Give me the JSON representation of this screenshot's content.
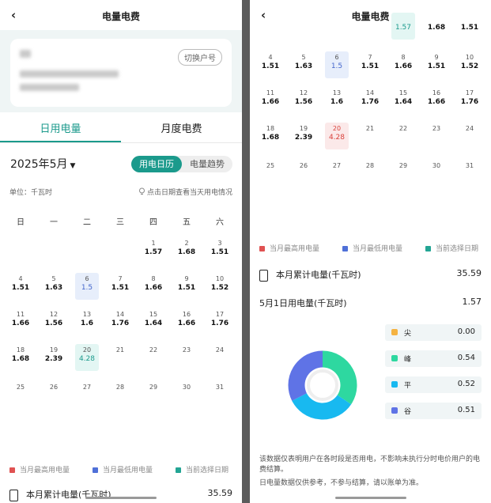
{
  "header": {
    "back": "‹",
    "title": "电量电费"
  },
  "account": {
    "switch_label": "切换户号"
  },
  "tabs": {
    "daily": "日用电量",
    "monthly": "月度电费"
  },
  "month": "2025年5月",
  "toggle": {
    "calendar": "用电日历",
    "trend": "电量趋势"
  },
  "unit_label": "单位：千瓦时",
  "tip": "点击日期查看当天用电情况",
  "weekdays": [
    "日",
    "一",
    "二",
    "三",
    "四",
    "五",
    "六"
  ],
  "days": [
    {
      "d": "1",
      "v": "1.57"
    },
    {
      "d": "2",
      "v": "1.68"
    },
    {
      "d": "3",
      "v": "1.51"
    },
    {
      "d": "4",
      "v": "1.51"
    },
    {
      "d": "5",
      "v": "1.63"
    },
    {
      "d": "6",
      "v": "1.5",
      "status": "low"
    },
    {
      "d": "7",
      "v": "1.51"
    },
    {
      "d": "8",
      "v": "1.66"
    },
    {
      "d": "9",
      "v": "1.51"
    },
    {
      "d": "10",
      "v": "1.52"
    },
    {
      "d": "11",
      "v": "1.66"
    },
    {
      "d": "12",
      "v": "1.56"
    },
    {
      "d": "13",
      "v": "1.6"
    },
    {
      "d": "14",
      "v": "1.76"
    },
    {
      "d": "15",
      "v": "1.64"
    },
    {
      "d": "16",
      "v": "1.66"
    },
    {
      "d": "17",
      "v": "1.76"
    },
    {
      "d": "18",
      "v": "1.68"
    },
    {
      "d": "19",
      "v": "2.39"
    },
    {
      "d": "20",
      "v": "4.28"
    },
    {
      "d": "21",
      "v": ""
    },
    {
      "d": "22",
      "v": ""
    },
    {
      "d": "23",
      "v": ""
    },
    {
      "d": "24",
      "v": ""
    },
    {
      "d": "25",
      "v": ""
    },
    {
      "d": "26",
      "v": ""
    },
    {
      "d": "27",
      "v": ""
    },
    {
      "d": "28",
      "v": ""
    },
    {
      "d": "29",
      "v": ""
    },
    {
      "d": "30",
      "v": ""
    },
    {
      "d": "31",
      "v": ""
    }
  ],
  "legend": {
    "high": "当月最高用电量",
    "low": "当月最低用电量",
    "selected": "当前选择日期"
  },
  "colors": {
    "accent": "#1b9a8c",
    "high": "#e05252",
    "low": "#4f70d8",
    "selected": "#23a594"
  },
  "summary": {
    "month_total_label": "本月累计电量(千瓦时)",
    "month_total": "35.59",
    "day_label": "5月1日用电量(千瓦时)",
    "day_value": "1.57"
  },
  "periods": [
    {
      "name": "尖",
      "value": "0.00",
      "color": "#f5b342"
    },
    {
      "name": "峰",
      "value": "0.54",
      "color": "#2ed8a0"
    },
    {
      "name": "平",
      "value": "0.52",
      "color": "#18b9f0"
    },
    {
      "name": "谷",
      "value": "0.51",
      "color": "#5f73e6"
    }
  ],
  "notes": [
    "该数据仅表明用户在各时段是否用电，不影响未执行分时电价用户的电费结算。",
    "日电量数据仅供参考，不参与结算，请以账单为准。"
  ]
}
